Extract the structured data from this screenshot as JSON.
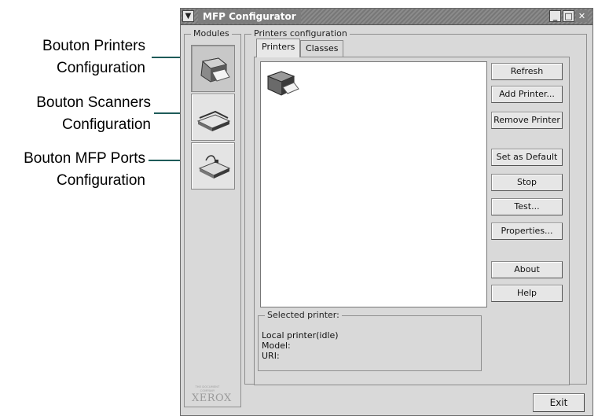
{
  "callouts": {
    "printers": [
      "Bouton Printers",
      "Configuration"
    ],
    "scanners": [
      "Bouton Scanners",
      "Configuration"
    ],
    "ports": [
      "Bouton MFP Ports",
      "Configuration"
    ],
    "accent_color": "#1e5b59"
  },
  "window": {
    "title": "MFP Configurator",
    "menu_icon": "chevron-down-icon",
    "controls": [
      "minimize-icon",
      "maximize-icon",
      "close-icon"
    ]
  },
  "modules": {
    "legend": "Modules",
    "buttons": [
      {
        "icon": "printer-icon",
        "active": true
      },
      {
        "icon": "scanner-icon",
        "active": false
      },
      {
        "icon": "mfp-port-icon",
        "active": false
      }
    ],
    "logo": {
      "tagline": "THE DOCUMENT COMPANY",
      "brand": "XEROX"
    }
  },
  "printers_config": {
    "legend": "Printers configuration",
    "tabs": [
      {
        "label": "Printers",
        "active": true
      },
      {
        "label": "Classes",
        "active": false
      }
    ],
    "list": [
      {
        "icon": "printer-icon",
        "label": ""
      }
    ],
    "actions": {
      "refresh": "Refresh",
      "add_printer": "Add Printer...",
      "remove_printer": "Remove Printer",
      "set_default": "Set as Default",
      "stop": "Stop",
      "test": "Test...",
      "properties": "Properties...",
      "about": "About",
      "help": "Help"
    },
    "selected": {
      "legend": "Selected printer:",
      "status": "Local printer(idle)",
      "model": "Model:",
      "uri": "URI:"
    }
  },
  "footer": {
    "exit": "Exit"
  }
}
